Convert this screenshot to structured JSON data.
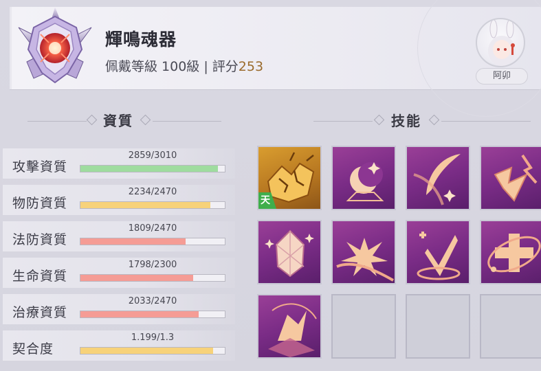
{
  "header": {
    "title": "輝鳴魂器",
    "sub_prefix": "佩戴等級 100級 | 評分",
    "score": "253",
    "avatar_name": "阿卯"
  },
  "sections": {
    "stats_title": "資質",
    "skills_title": "技能"
  },
  "stats": [
    {
      "label": "攻擊資質",
      "value": "2859/3010",
      "fraction": 0.95,
      "color": "#9fdc9f"
    },
    {
      "label": "物防資質",
      "value": "2234/2470",
      "fraction": 0.9,
      "color": "#f7d27a"
    },
    {
      "label": "法防資質",
      "value": "1809/2470",
      "fraction": 0.73,
      "color": "#f59c95"
    },
    {
      "label": "生命資質",
      "value": "1798/2300",
      "fraction": 0.78,
      "color": "#f59c95"
    },
    {
      "label": "治療資質",
      "value": "2033/2470",
      "fraction": 0.82,
      "color": "#f59c95"
    },
    {
      "label": "契合度",
      "value": "1.199/1.3",
      "fraction": 0.92,
      "color": "#f7d27a"
    }
  ],
  "skills": {
    "tag_label": "天",
    "icons": [
      "cracked-gold-icon",
      "crescent-moon-icon",
      "feather-icon",
      "lightning-arrow-icon",
      "crystal-icon",
      "burst-icon",
      "heal-arrow-icon",
      "plus-orbit-icon",
      "crystal-shard-icon",
      "",
      "",
      ""
    ]
  }
}
